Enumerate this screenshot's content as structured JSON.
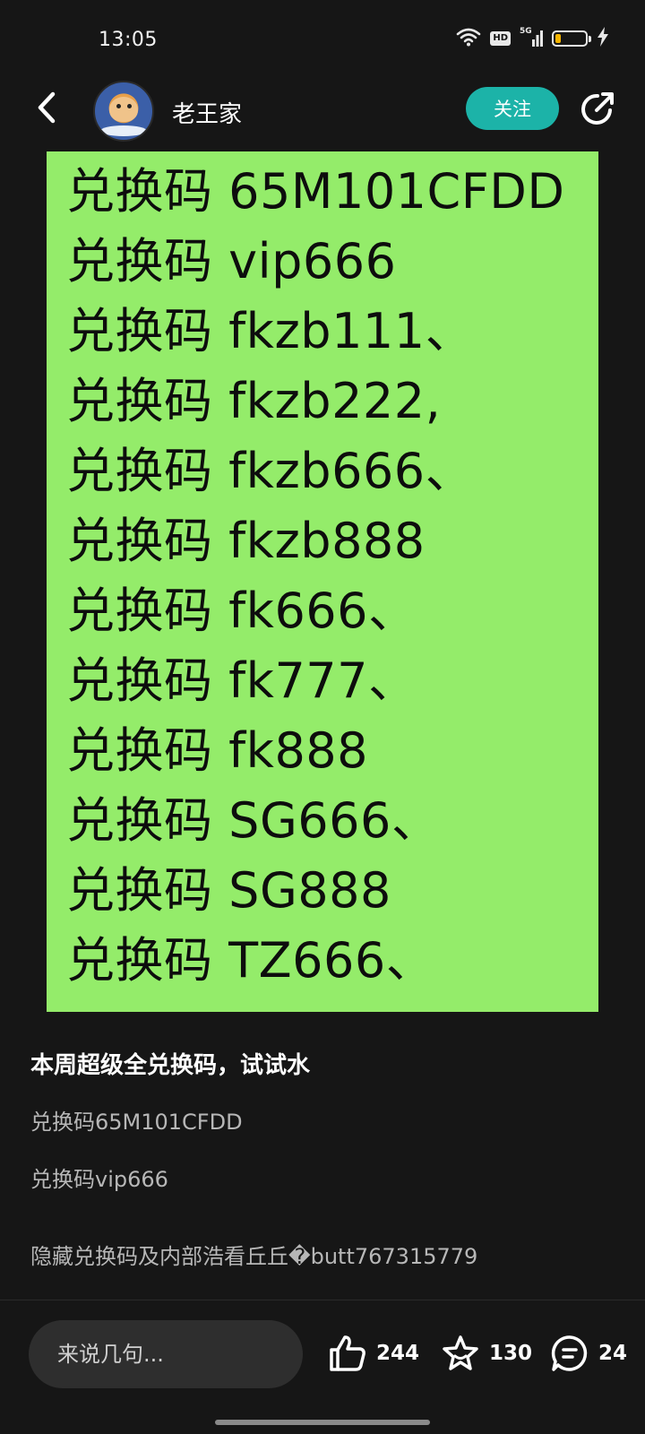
{
  "status_bar": {
    "time": "13:05",
    "hd_label": "HD",
    "network_label": "5G",
    "battery_level_percent": 20
  },
  "header": {
    "username": "老王家",
    "follow_label": "关注"
  },
  "post_image": {
    "lines": [
      "兑换码 65M101CFDD",
      "兑换码 vip666",
      "兑换码 fkzb111、",
      "兑换码 fkzb222,",
      "兑换码 fkzb666、",
      "兑换码 fkzb888",
      "兑换码 fk666、",
      "兑换码 fk777、",
      "兑换码  fk888",
      "兑换码 SG666、",
      "兑换码 SG888",
      "兑换码 TZ666、"
    ]
  },
  "post": {
    "title": "本周超级全兑换码，试试水",
    "body_lines": [
      "兑换码65M101CFDD",
      "兑换码vip666",
      "隐藏兑换码及内部浩看丘丘�butt767315779"
    ]
  },
  "bottom_bar": {
    "comment_placeholder": "来说几句...",
    "like_count": "244",
    "favorite_count": "130",
    "comment_count": "24"
  },
  "colors": {
    "accent": "#1cb3a8",
    "image_bg": "#94ec6a",
    "background": "#161616"
  }
}
